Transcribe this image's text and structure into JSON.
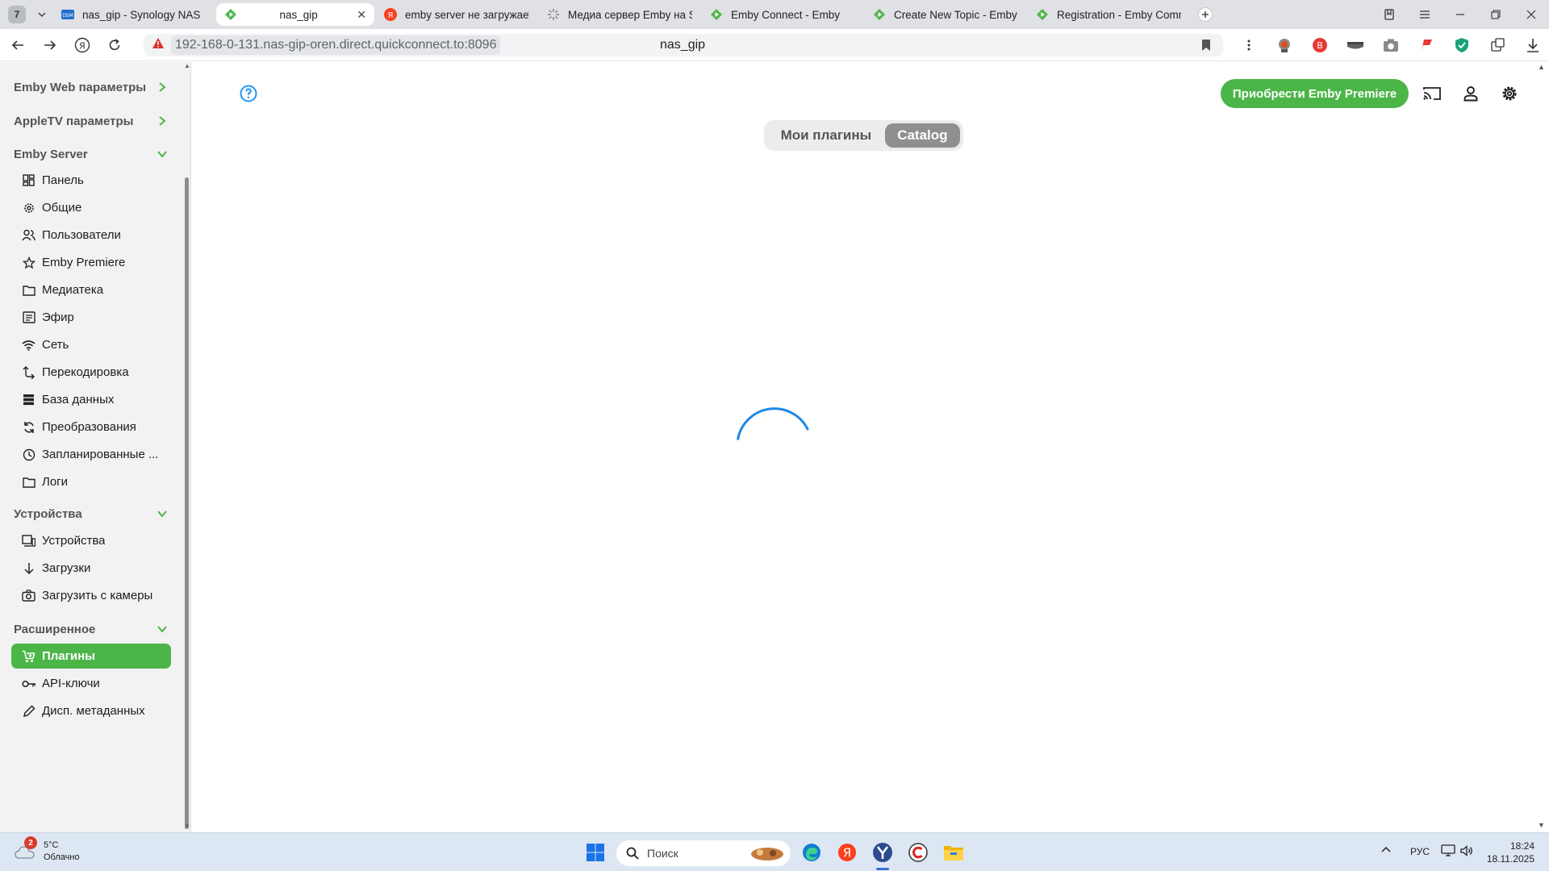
{
  "browser": {
    "tab_count": "7",
    "tabs": [
      {
        "label": "nas_gip - Synology NAS",
        "favicon": "dsm-icon"
      },
      {
        "label": "nas_gip",
        "favicon": "emby-icon",
        "active": true
      },
      {
        "label": "emby server не загружает",
        "favicon": "yandex-icon"
      },
      {
        "label": "Медиа сервер Emby на Sy",
        "favicon": "loading-icon"
      },
      {
        "label": "Emby Connect - Emby",
        "favicon": "emby-icon"
      },
      {
        "label": "Create New Topic - Emby C",
        "favicon": "emby-icon"
      },
      {
        "label": "Registration - Emby Comm",
        "favicon": "emby-icon"
      }
    ],
    "url": "192-168-0-131.nas-gip-oren.direct.quickconnect.to:8096",
    "page_title": "nas_gip"
  },
  "sidebar": {
    "top_links": [
      {
        "label": "Emby Web параметры"
      },
      {
        "label": "AppleTV параметры"
      }
    ],
    "server": {
      "title": "Emby Server",
      "items": [
        {
          "label": "Панель",
          "icon": "dashboard-icon"
        },
        {
          "label": "Общие",
          "icon": "gear-icon"
        },
        {
          "label": "Пользователи",
          "icon": "users-icon"
        },
        {
          "label": "Emby Premiere",
          "icon": "star-icon"
        },
        {
          "label": "Медиатека",
          "icon": "folder-icon"
        },
        {
          "label": "Эфир",
          "icon": "tv-guide-icon"
        },
        {
          "label": "Сеть",
          "icon": "wifi-icon"
        },
        {
          "label": "Перекодировка",
          "icon": "transcode-icon"
        },
        {
          "label": "База данных",
          "icon": "database-icon"
        },
        {
          "label": "Преобразования",
          "icon": "convert-icon"
        },
        {
          "label": "Запланированные ...",
          "icon": "clock-icon"
        },
        {
          "label": "Логи",
          "icon": "folder-icon"
        }
      ]
    },
    "devices": {
      "title": "Устройства",
      "items": [
        {
          "label": "Устройства",
          "icon": "devices-icon"
        },
        {
          "label": "Загрузки",
          "icon": "download-icon"
        },
        {
          "label": "Загрузить с камеры",
          "icon": "camera-icon"
        }
      ]
    },
    "advanced": {
      "title": "Расширенное",
      "items": [
        {
          "label": "Плагины",
          "icon": "cart-icon",
          "active": true
        },
        {
          "label": "API-ключи",
          "icon": "key-icon"
        },
        {
          "label": "Дисп. метаданных",
          "icon": "pencil-icon"
        }
      ]
    }
  },
  "main": {
    "premiere_button": "Приобрести Emby Premiere",
    "segment": {
      "my_plugins": "Мои плагины",
      "catalog": "Catalog",
      "selected": "Catalog"
    }
  },
  "taskbar": {
    "weather_badge": "2",
    "temperature": "5°C",
    "condition": "Облачно",
    "search_placeholder": "Поиск",
    "language": "РУС",
    "time": "18:24",
    "date": "18.11.2025"
  },
  "colors": {
    "accent_green": "#4cb548",
    "spinner_blue": "#1e88e5",
    "help_blue": "#2196f3"
  }
}
